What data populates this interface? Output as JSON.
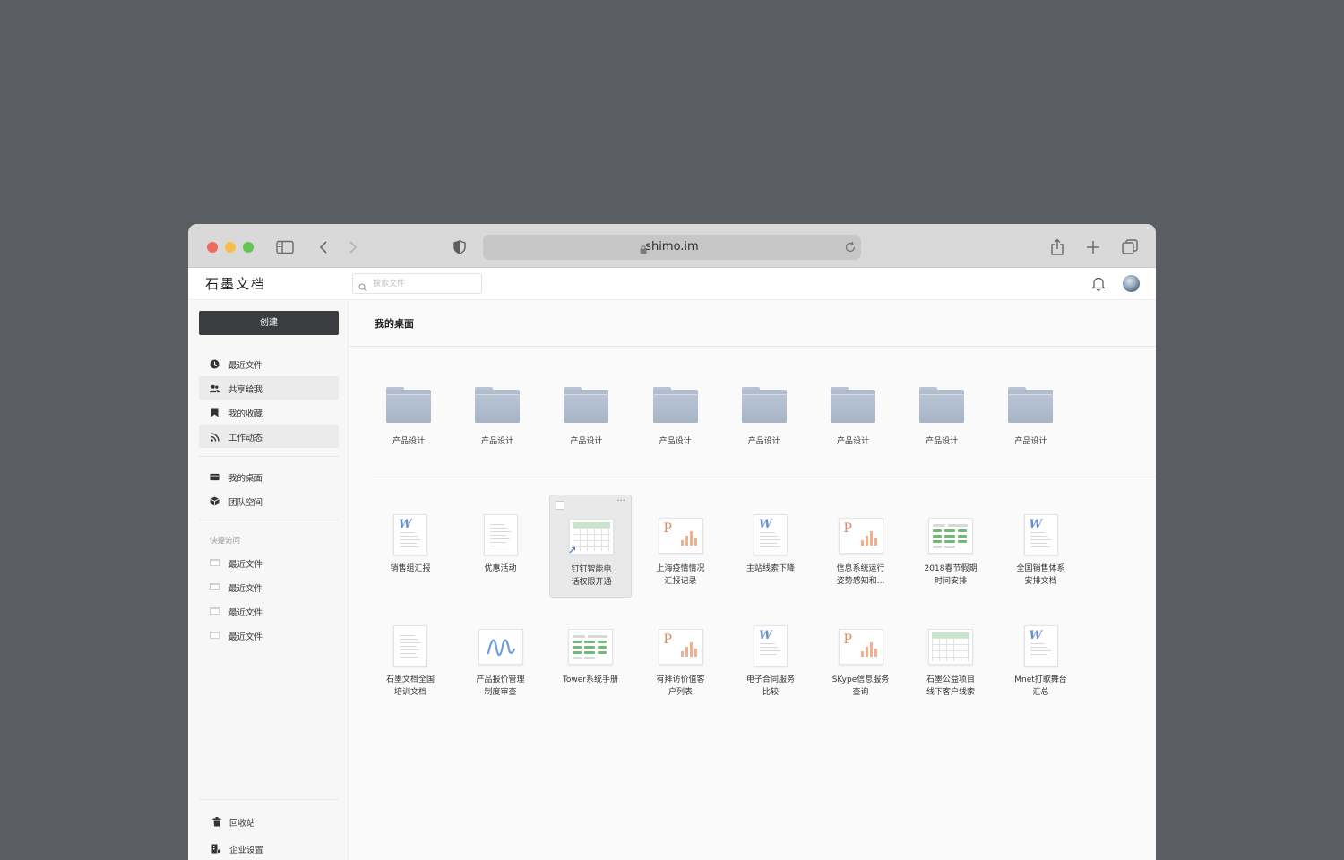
{
  "browser": {
    "url": "shimo.im"
  },
  "header": {
    "logo": "石墨文档",
    "search_placeholder": "搜索文件"
  },
  "sidebar": {
    "create_label": "创建",
    "nav": [
      {
        "label": "最近文件",
        "icon": "clock-icon"
      },
      {
        "label": "共享给我",
        "icon": "users-icon"
      },
      {
        "label": "我的收藏",
        "icon": "bookmark-icon"
      },
      {
        "label": "工作动态",
        "icon": "feed-icon"
      }
    ],
    "spaces": [
      {
        "label": "我的桌面",
        "icon": "desktop-icon"
      },
      {
        "label": "团队空间",
        "icon": "cube-icon"
      }
    ],
    "quick_access_title": "快捷访问",
    "quick_access": [
      {
        "label": "最近文件"
      },
      {
        "label": "最近文件"
      },
      {
        "label": "最近文件"
      },
      {
        "label": "最近文件"
      }
    ],
    "footer": [
      {
        "label": "回收站",
        "icon": "trash-icon"
      },
      {
        "label": "企业设置",
        "icon": "settings-icon"
      }
    ]
  },
  "main": {
    "title": "我的桌面",
    "folders": [
      {
        "label": "产品设计"
      },
      {
        "label": "产品设计"
      },
      {
        "label": "产品设计"
      },
      {
        "label": "产品设计"
      },
      {
        "label": "产品设计"
      },
      {
        "label": "产品设计"
      },
      {
        "label": "产品设计"
      },
      {
        "label": "产品设计"
      }
    ],
    "files_row1": [
      {
        "line1": "销售组汇报",
        "line2": "",
        "type": "word"
      },
      {
        "line1": "优惠活动",
        "line2": "",
        "type": "doc"
      },
      {
        "line1": "钉钉智能电",
        "line2": "话权限开通",
        "type": "sheet-grid",
        "selected": true,
        "more": "···"
      },
      {
        "line1": "上海疫情情况",
        "line2": "汇报记录",
        "type": "ppt"
      },
      {
        "line1": "主站线索下降",
        "line2": "",
        "type": "word"
      },
      {
        "line1": "信息系统运行",
        "line2": "姿势感知和...",
        "type": "ppt"
      },
      {
        "line1": "2018春节假期",
        "line2": "时间安排",
        "type": "sheet"
      },
      {
        "line1": "全国销售体系",
        "line2": "安排文档",
        "type": "word"
      }
    ],
    "files_row2": [
      {
        "line1": "石墨文档全国",
        "line2": "培训文档",
        "type": "doc"
      },
      {
        "line1": "产品报价管理",
        "line2": "制度审查",
        "type": "board"
      },
      {
        "line1": "Tower系统手册",
        "line2": "",
        "type": "sheet"
      },
      {
        "line1": "有拜访价值客",
        "line2": "户列表",
        "type": "ppt"
      },
      {
        "line1": "电子合同服务",
        "line2": "比较",
        "type": "word"
      },
      {
        "line1": "SKype信息服务",
        "line2": "查询",
        "type": "ppt"
      },
      {
        "line1": "石墨公益项目",
        "line2": "线下客户线索",
        "type": "sheet-grid"
      },
      {
        "line1": "Mnet打歌舞台",
        "line2": "汇总",
        "type": "word"
      }
    ]
  },
  "colors": {
    "background": "#5a5d62",
    "create_button": "#3a3c40",
    "folder": "#b1bdcd",
    "word_accent": "#6b8fd0",
    "ppt_accent": "#dd8a5a",
    "sheet_accent": "#6dbb76"
  }
}
